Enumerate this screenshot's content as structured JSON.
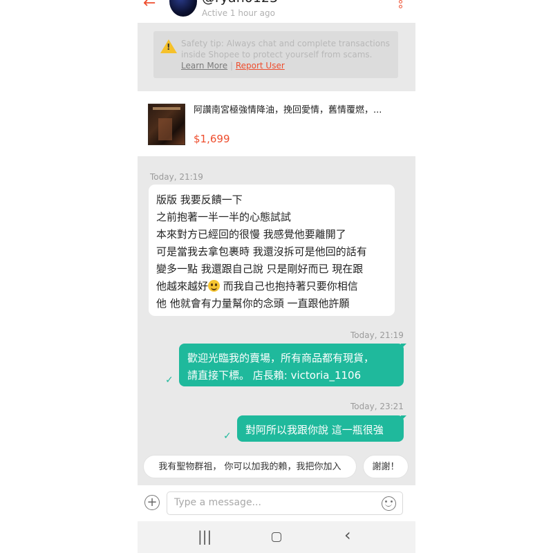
{
  "header": {
    "username": "@ryan0123",
    "status": "Active 1 hour ago"
  },
  "safety_tip": {
    "text": "Safety tip: Always chat and complete transactions inside Shopee to protect yourself from scams.",
    "learn_more": "Learn More",
    "separator": "|",
    "report": "Report User"
  },
  "product": {
    "title": "阿讚南宮極強情降油，挽回愛情，舊情覆燃，...",
    "price": "$1,699"
  },
  "messages": {
    "in_time": "Today, 21:19",
    "in_lines": [
      "版版 我要反饋一下",
      "之前抱著一半一半的心態試試",
      "本來對方已經回的很慢 我感覺他要離開了",
      "可是當我去拿包裹時 我還沒拆可是他回的話有",
      "變多一點 我還跟自己說 只是剛好而已 現在跟",
      "他越來越好",
      " 而我自己也抱持著只要你相信",
      "他 他就會有力量幫你的念頭 一直跟他許願"
    ],
    "out1_time": "Today, 21:19",
    "out1_line1": "歡迎光臨我的賣場，所有商品都有現貨，",
    "out1_line2": "請直接下標。 店長賴: victoria_1106",
    "out2_time": "Today, 23:21",
    "out2_text": "對阿所以我跟你說 這一瓶很強",
    "check": "✓"
  },
  "quick_replies": [
    "我有聖物群祖， 你可以加我的賴，我把你加入",
    "謝謝！"
  ],
  "input": {
    "placeholder": "Type a message..."
  },
  "icons": {
    "back": "←",
    "plus": "+",
    "recents": "|||",
    "back_nav": "‹"
  },
  "colors": {
    "accent": "#ee4d2d",
    "bubble_out": "#1fb99c"
  }
}
